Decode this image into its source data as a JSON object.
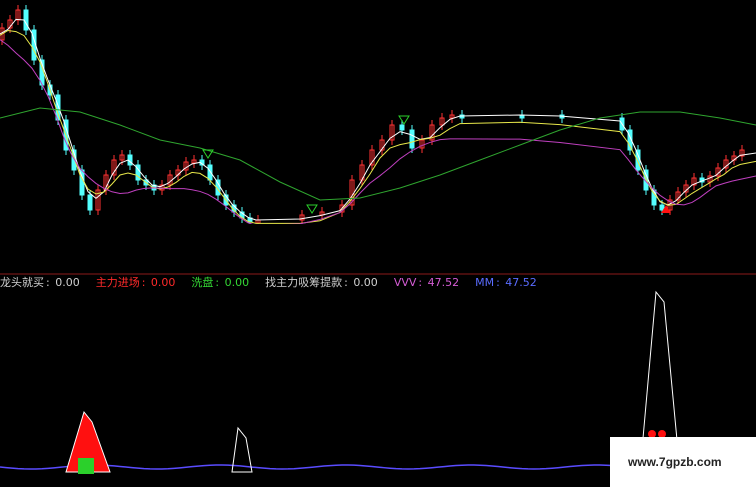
{
  "indicator_panel": {
    "items": [
      {
        "label": "龙头就买",
        "sep": ":",
        "value": "0.00",
        "label_color": "#d0d0d0",
        "value_color": "#d0d0d0"
      },
      {
        "label": "主力进场",
        "sep": ":",
        "value": "0.00",
        "label_color": "#ff2a2a",
        "value_color": "#ff2a2a"
      },
      {
        "label": "洗盘",
        "sep": ":",
        "value": "0.00",
        "label_color": "#34d634",
        "value_color": "#34d634"
      },
      {
        "label": "找主力吸筹提款",
        "sep": ":",
        "value": "0.00",
        "label_color": "#d0d0d0",
        "value_color": "#d0d0d0"
      },
      {
        "label": "VVV",
        "sep": ":",
        "value": "47.52",
        "label_color": "#d45cd4",
        "value_color": "#d45cd4"
      },
      {
        "label": "MM",
        "sep": ":",
        "value": "47.52",
        "label_color": "#5a6cff",
        "value_color": "#5a6cff"
      }
    ]
  },
  "watermark": {
    "text": "www.7gpzb.com"
  },
  "colors": {
    "up_candle": "#ff3232",
    "down_candle": "#54ffff",
    "ma_white": "#ffffff",
    "ma_yellow": "#e8e84a",
    "ma_magenta": "#c040c0",
    "ma_green": "#2fa52f",
    "divider": "#8b1a1a",
    "signal_red": "#ff1010",
    "signal_green": "#2bd02b",
    "mm_line": "#5a4cff",
    "vvv_line": "#c040c0"
  },
  "chart_data": [
    {
      "type": "candlestick",
      "panel": "main",
      "note_visible": "",
      "series": [
        {
          "name": "",
          "kind": "ma_white"
        },
        {
          "name": "",
          "kind": "ma_yellow"
        },
        {
          "name": "",
          "kind": "ma_magenta"
        },
        {
          "name": "",
          "kind": "ma_green"
        }
      ]
    },
    {
      "type": "line",
      "panel": "indicator",
      "series": [
        {
          "name": "VVV",
          "value": 47.52
        },
        {
          "name": "MM",
          "value": 47.52
        }
      ]
    }
  ]
}
